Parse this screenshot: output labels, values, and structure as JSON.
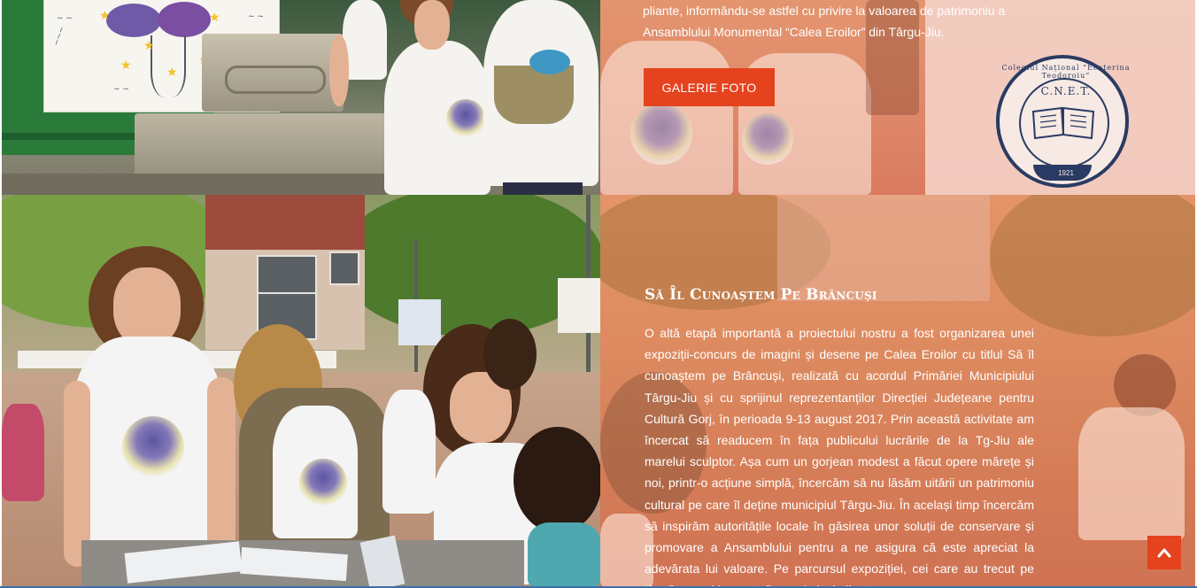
{
  "top_block": {
    "text": "pliante, informându-se astfel cu privire la valoarea de patrimoniu a Ansamblului Monumental “Calea Eroilor” din Târgu-Jiu.",
    "button_label": "GALERIE FOTO"
  },
  "badge": {
    "initials": "C.N.E.T.",
    "ring_text": "Colegiul Național “Ecaterina Teodoroiu”",
    "year": "1921"
  },
  "section": {
    "title": "Să Îl Cunoaștem Pe Brâncuși",
    "body": "O altă etapă importantă a proiectului nostru a fost organizarea unei expoziții-concurs de imagini și desene pe Calea Eroilor cu titlul Să îl cunoaștem pe Brâncuși, realizată cu acordul Primăriei Municipiului Târgu-Jiu și cu sprijinul reprezentanților Direcției Județeane pentru Cultură Gorj, în perioada 9-13 august 2017. Prin această activitate am încercat să readucem în fața publicului lucrările de la Tg-Jiu ale marelui sculptor. Așa cum un gorjean modest a făcut opere mărețe și noi, printr-o acțiune simplă, încercăm să nu lăsăm uitării un patrimoniu cultural pe care îl deține municipiul Târgu-Jiu. În același timp încercăm să inspirăm autoritățile locale în găsirea unor soluții de conservare și promovare a Ansamblului pentru a ne asigura că este apreciat la adevărata lui valoare. Pe parcursul expoziției, cei care au trecut pe lângă expoziția noastră au primit și pliante."
  },
  "colors": {
    "accent": "#e5421e",
    "overlay": "#e0896a",
    "text": "#ffffff"
  },
  "icons": {
    "scroll_top": "chevron-up-icon"
  }
}
